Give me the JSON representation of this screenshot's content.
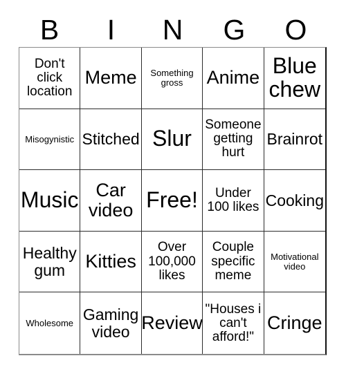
{
  "header": {
    "letters": [
      "B",
      "I",
      "N",
      "G",
      "O"
    ]
  },
  "grid": {
    "columns": 5,
    "rows": 5,
    "cells": [
      {
        "text": "Don't click location",
        "size": "s"
      },
      {
        "text": "Meme",
        "size": "l"
      },
      {
        "text": "Something gross",
        "size": "xs"
      },
      {
        "text": "Anime",
        "size": "l"
      },
      {
        "text": "Blue chew",
        "size": "xl"
      },
      {
        "text": "Misogynistic",
        "size": "xs"
      },
      {
        "text": "Stitched",
        "size": "m"
      },
      {
        "text": "Slur",
        "size": "xl"
      },
      {
        "text": "Someone getting hurt",
        "size": "s"
      },
      {
        "text": "Brainrot",
        "size": "m"
      },
      {
        "text": "Music",
        "size": "xl"
      },
      {
        "text": "Car video",
        "size": "l"
      },
      {
        "text": "Free!",
        "size": "xl"
      },
      {
        "text": "Under 100 likes",
        "size": "s"
      },
      {
        "text": "Cooking",
        "size": "m"
      },
      {
        "text": "Healthy gum",
        "size": "m"
      },
      {
        "text": "Kitties",
        "size": "l"
      },
      {
        "text": "Over 100,000 likes",
        "size": "s"
      },
      {
        "text": "Couple specific meme",
        "size": "s"
      },
      {
        "text": "Motivational video",
        "size": "xs"
      },
      {
        "text": "Wholesome",
        "size": "xs"
      },
      {
        "text": "Gaming video",
        "size": "m"
      },
      {
        "text": "Review",
        "size": "l"
      },
      {
        "text": "\"Houses i can't afford!\"",
        "size": "s"
      },
      {
        "text": "Cringe",
        "size": "l"
      }
    ]
  },
  "colors": {
    "background": "#ffffff",
    "text": "#000000",
    "grid_line": "#2b2b2b",
    "grid_outer": "#8a8a8a"
  }
}
